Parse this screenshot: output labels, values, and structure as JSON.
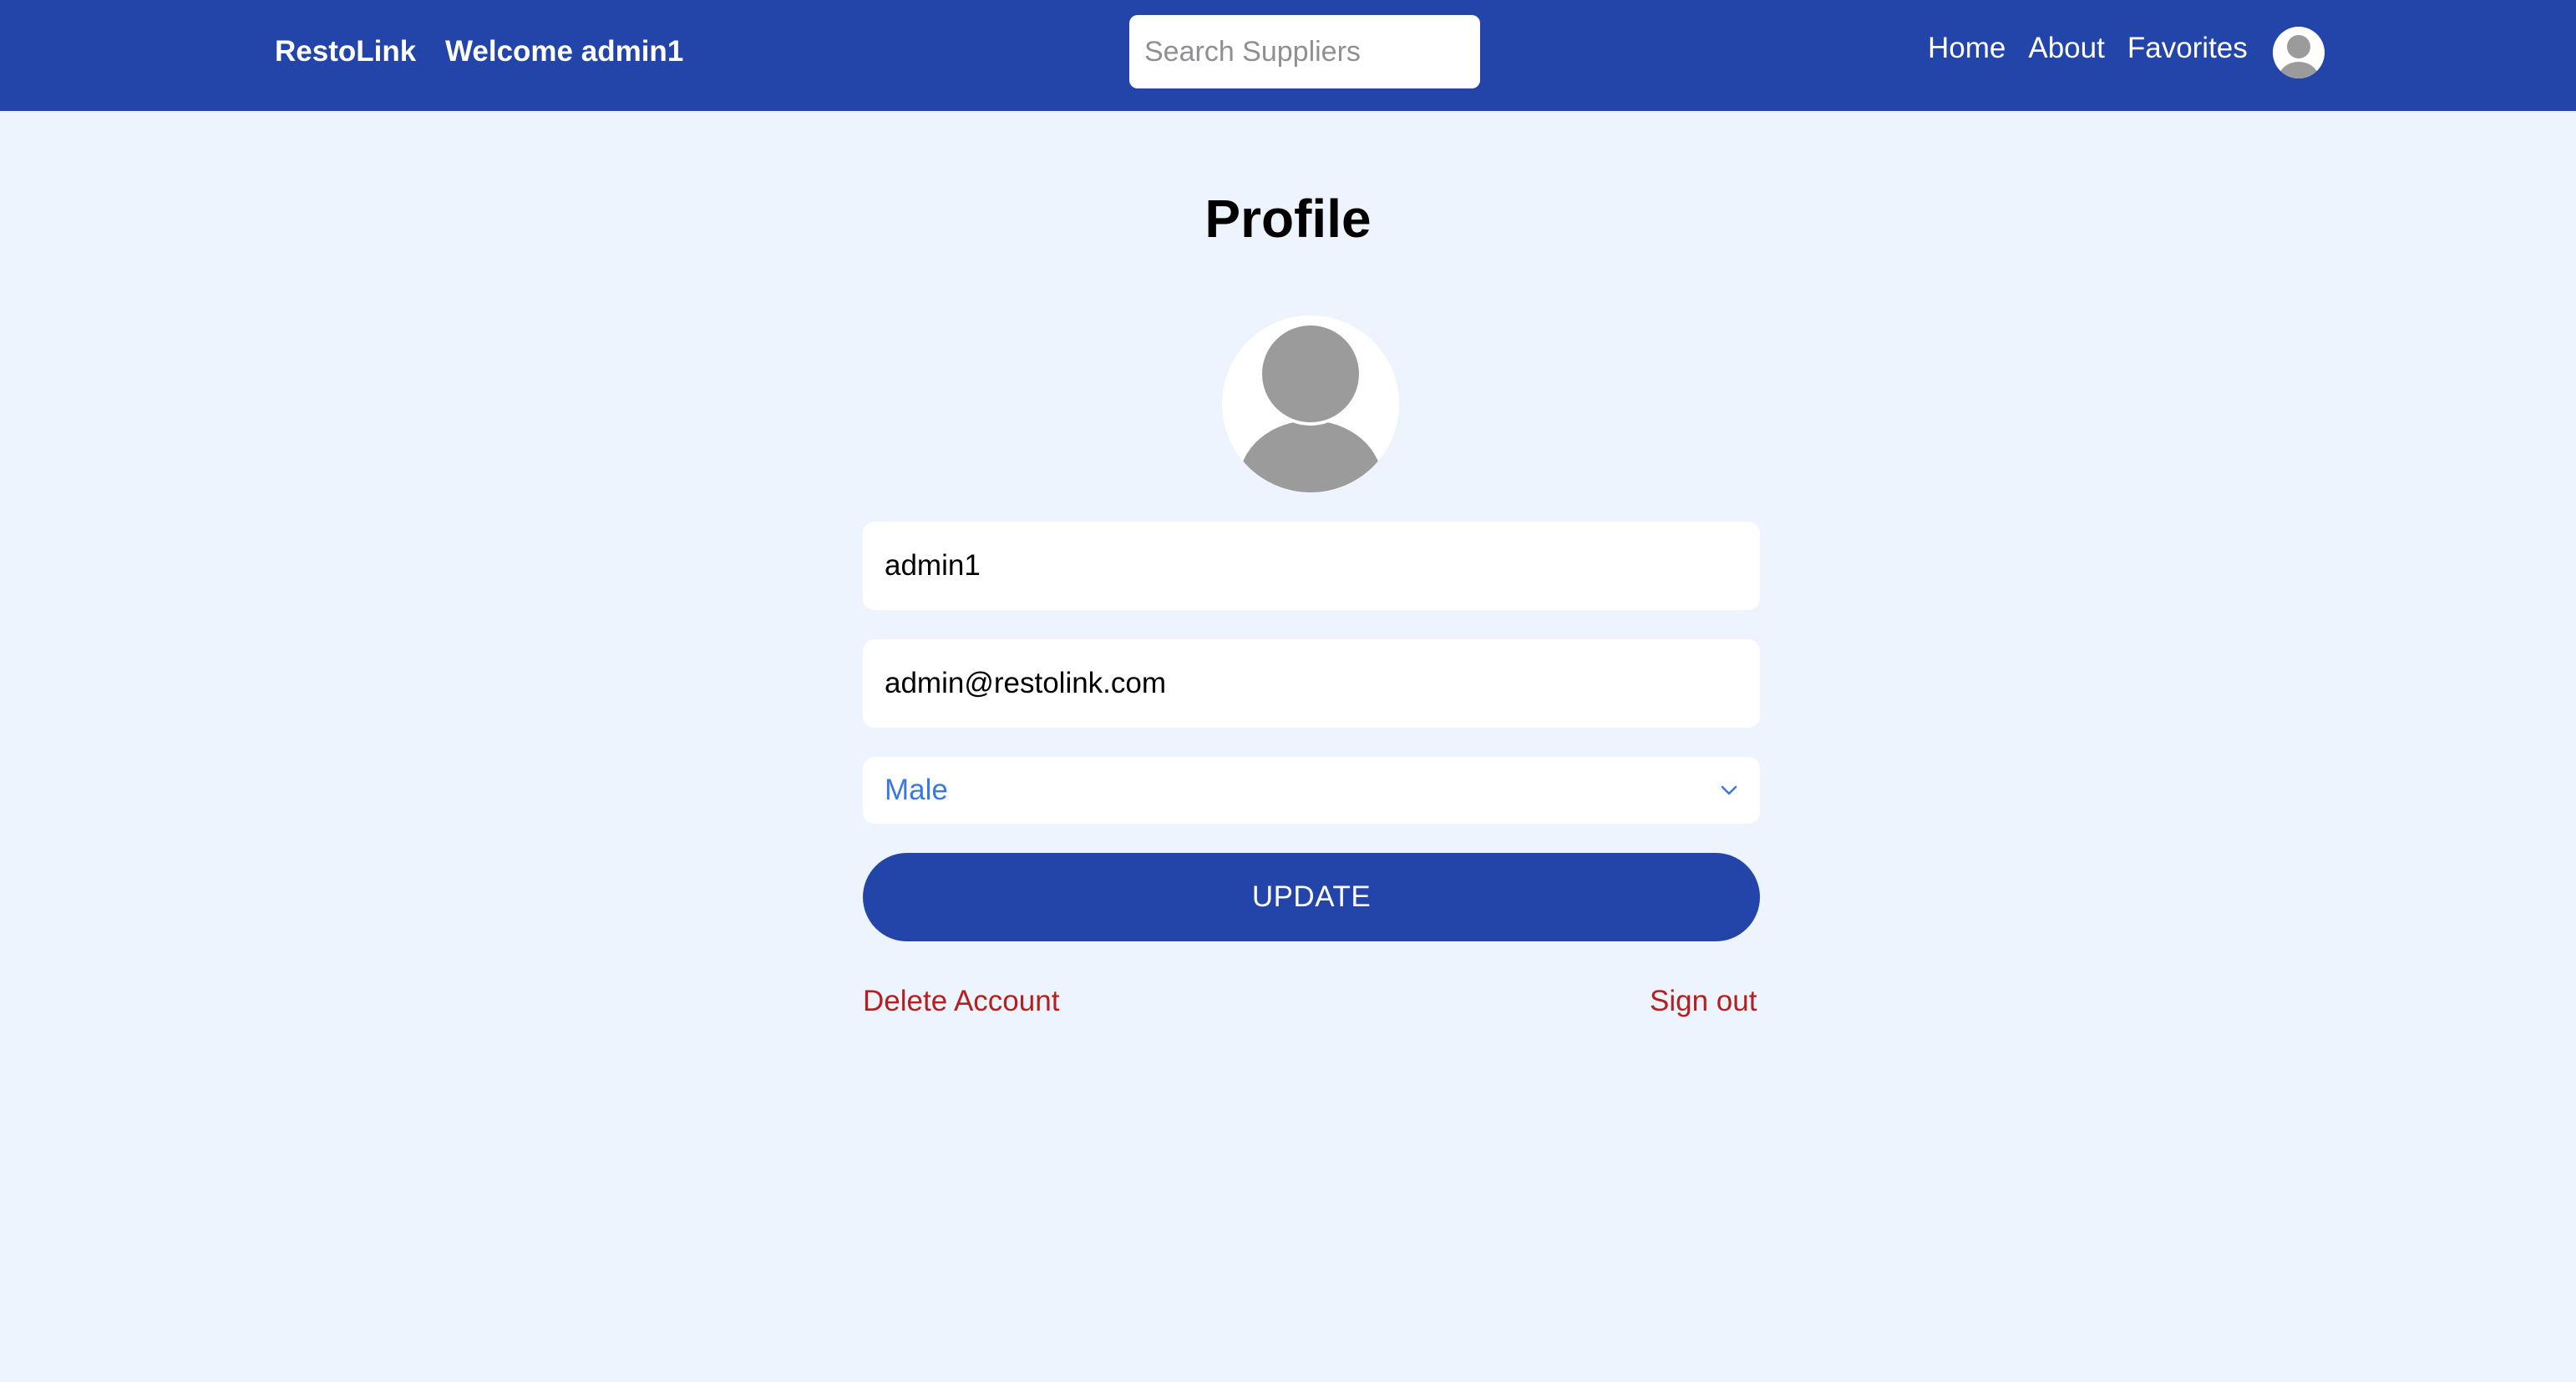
{
  "navbar": {
    "brand": "RestoLink",
    "welcome": "Welcome admin1",
    "search": {
      "placeholder": "Search Suppliers",
      "value": ""
    },
    "links": [
      "Home",
      "About",
      "Favorites"
    ],
    "avatar_icon": "user-avatar-icon"
  },
  "profile": {
    "title": "Profile",
    "avatar_icon": "user-avatar-icon",
    "username": "admin1",
    "email": "admin@restolink.com",
    "gender": "Male",
    "dropdown_icon": "chevron-down-icon",
    "update_label": "UPDATE",
    "delete_label": "Delete Account",
    "signout_label": "Sign out"
  },
  "colors": {
    "navbar_bg": "#2344a9",
    "page_bg": "#eef4fd",
    "button_bg": "#2344a9",
    "danger_text": "#b51f1f",
    "select_text": "#3a78e0",
    "avatar_gray": "#9b9b9b"
  }
}
